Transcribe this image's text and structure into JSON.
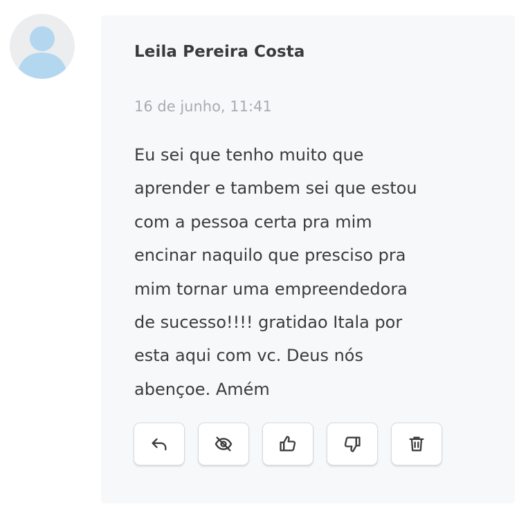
{
  "comment": {
    "author": "Leila Pereira Costa",
    "timestamp": "16 de junho, 11:41",
    "body_lines": [
      "Eu sei que tenho muito que",
      "aprender e tambem sei que estou",
      "com a pessoa certa pra mim",
      "encinar naquilo que presciso pra",
      "mim tornar uma empreendedora",
      "de sucesso!!!! gratidao Itala por",
      "esta aqui com vc. Deus nós",
      "abençoe. Amém"
    ]
  },
  "actions": [
    {
      "icon": "reply-icon"
    },
    {
      "icon": "eye-off-icon"
    },
    {
      "icon": "thumbs-up-icon"
    },
    {
      "icon": "thumbs-down-icon"
    },
    {
      "icon": "trash-icon"
    }
  ],
  "colors": {
    "card_background": "#f7f8fa",
    "author_text": "#3a3a3a",
    "timestamp_text": "#a8abaf",
    "body_text": "#3b3b3b",
    "avatar_background": "#ebedef",
    "avatar_figure": "#b3d7ee",
    "button_border": "#d7d9dc",
    "icon_stroke": "#3c3c3c"
  }
}
